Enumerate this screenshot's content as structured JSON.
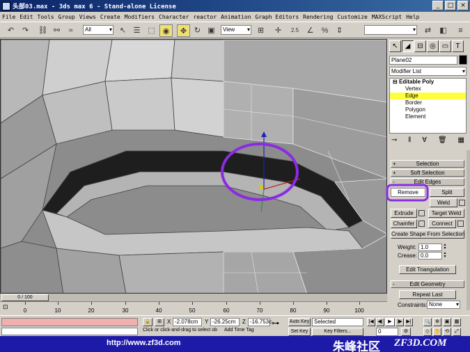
{
  "window": {
    "title": "头部03.max - 3ds max 6 - Stand-alone License",
    "controls": [
      "_",
      "□",
      "×"
    ]
  },
  "menu": [
    "File",
    "Edit",
    "Tools",
    "Group",
    "Views",
    "Create",
    "Modifiers",
    "Character",
    "reactor",
    "Animation",
    "Graph Editors",
    "Rendering",
    "Customize",
    "MAXScript",
    "Help"
  ],
  "toolbar": {
    "selection_filter": "All",
    "reference_coord": "View",
    "snap_value": "2.5",
    "named_selection": ""
  },
  "viewport": {
    "label": "",
    "highlight_color": "#8a2be2"
  },
  "command_panel": {
    "object_name": "Plane02",
    "object_color": "#000000",
    "modifier_list": "Modifier List",
    "stack": {
      "root": "Editable Poly",
      "items": [
        "Vertex",
        "Edge",
        "Border",
        "Polygon",
        "Element"
      ],
      "selected": "Edge"
    },
    "rollouts": {
      "selection": "Selection",
      "soft_selection": "Soft Selection",
      "edit_edges": "Edit Edges",
      "edit_geometry": "Edit Geometry"
    },
    "edit_edges": {
      "remove": "Remove",
      "split": "Split",
      "weld": "Weld",
      "extrude": "Extrude",
      "target_weld": "Target Weld",
      "chamfer": "Chamfer",
      "connect": "Connect",
      "create_shape": "Create Shape From Selection",
      "weight_label": "Weight:",
      "weight_value": "1.0",
      "crease_label": "Crease:",
      "crease_value": "0.0",
      "edit_triangulation": "Edit Triangulation"
    },
    "edit_geometry": {
      "repeat_last": "Repeat Last",
      "constraints_label": "Constraints:",
      "constraints_value": "None"
    }
  },
  "timeline": {
    "frame_display": "0 / 100",
    "ticks": [
      "0",
      "10",
      "20",
      "30",
      "40",
      "50",
      "60",
      "70",
      "80",
      "90",
      "100"
    ]
  },
  "status": {
    "x_label": "X",
    "x_value": "-2.078cm",
    "y_label": "Y",
    "y_value": "-26.25cm",
    "z_label": "Z",
    "z_value": "-16.753c",
    "auto_key": "Auto Key",
    "set_key": "Set Key",
    "key_mode": "Selected",
    "key_filters": "Key Filters...",
    "frame": "0",
    "prompt": "Click or click-and-drag to select ob",
    "add_time_tag": "Add Time Tag"
  },
  "banner": {
    "url": "http://www.zf3d.com",
    "cn_name": "朱峰社区",
    "en_name": "ZF3D.COM",
    "color": "#1e1aa8"
  }
}
